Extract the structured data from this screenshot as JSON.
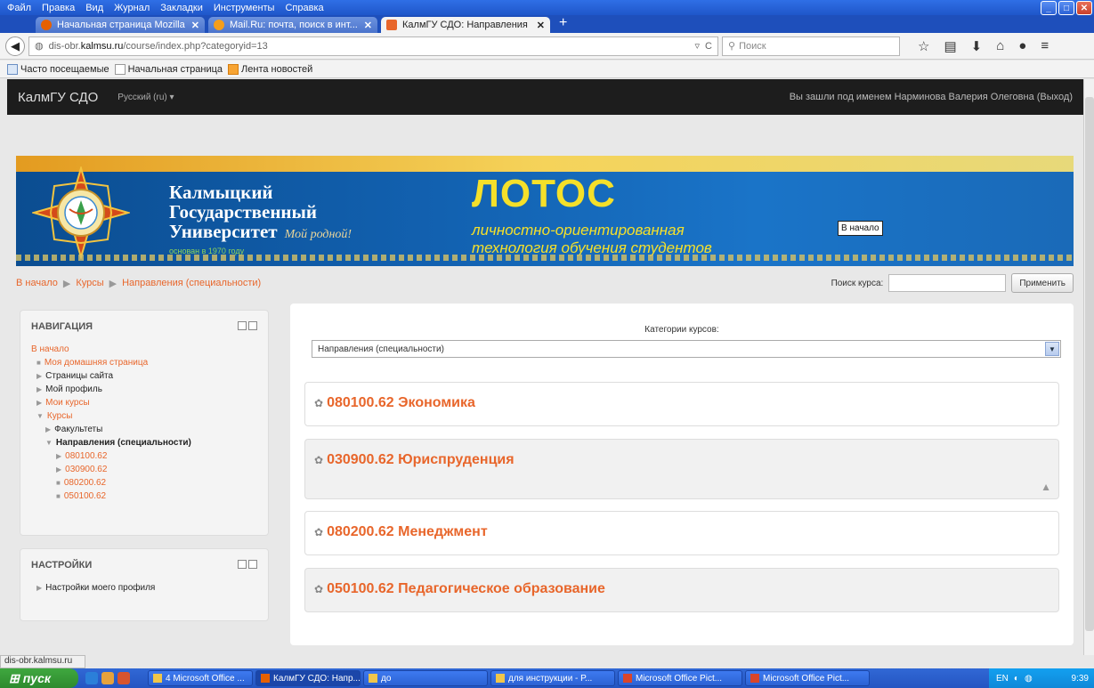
{
  "menu": [
    "Файл",
    "Правка",
    "Вид",
    "Журнал",
    "Закладки",
    "Инструменты",
    "Справка"
  ],
  "tabs": [
    {
      "label": "Начальная страница Mozilla ...",
      "active": false
    },
    {
      "label": "Mail.Ru: почта, поиск в инт...",
      "active": false
    },
    {
      "label": "КалмГУ СДО: Направления ...",
      "active": true
    }
  ],
  "url": {
    "prefix": "dis-obr.",
    "host": "kalmsu.ru",
    "path": "/course/index.php?categoryid=13"
  },
  "search_placeholder": "Поиск",
  "bookmarks": [
    "Часто посещаемые",
    "Начальная страница",
    "Лента новостей"
  ],
  "site": {
    "brand": "КалмГУ СДО",
    "lang": "Русский (ru) ▾",
    "login": "Вы зашли под именем Нарминова Валерия Олеговна (Выход)"
  },
  "header": {
    "uni_line1": "Калмыцкий",
    "uni_line2": "Государственный",
    "uni_line3": "Университет",
    "motto": "Мой родной!",
    "founded": "основан в 1970 году",
    "lotos": "ЛОТОС",
    "lotos_sub1": "личностно-ориентированная",
    "lotos_sub2": "технология обучения студентов",
    "tooltip": "В начало"
  },
  "breadcrumb": [
    "В начало",
    "Курсы",
    "Направления (специальности)"
  ],
  "course_search": {
    "label": "Поиск курса:",
    "button": "Применить"
  },
  "navigation": {
    "title": "НАВИГАЦИЯ",
    "home": "В начало",
    "my_home": "Моя домашняя страница",
    "site_pages": "Страницы сайта",
    "my_profile": "Мой профиль",
    "my_courses": "Мои курсы",
    "courses": "Курсы",
    "faculties": "Факультеты",
    "directions": "Направления (специальности)",
    "sub": [
      "080100.62",
      "030900.62",
      "080200.62",
      "050100.62"
    ]
  },
  "settings": {
    "title": "НАСТРОЙКИ",
    "profile": "Настройки моего профиля"
  },
  "categories": {
    "label": "Категории курсов:",
    "selected": "Направления (специальности)",
    "items": [
      "080100.62 Экономика",
      "030900.62 Юриспруденция",
      "080200.62 Менеджмент",
      "050100.62 Педагогическое образование"
    ]
  },
  "status_url": "dis-obr.kalmsu.ru",
  "taskbar": {
    "start": "пуск",
    "buttons": [
      "4 Microsoft Office ...",
      "КалмГУ СДО: Напр...",
      "до",
      "для инструкции - Р...",
      "Microsoft Office Pict...",
      "Microsoft Office Pict..."
    ],
    "lang": "EN",
    "clock": "9:39"
  }
}
